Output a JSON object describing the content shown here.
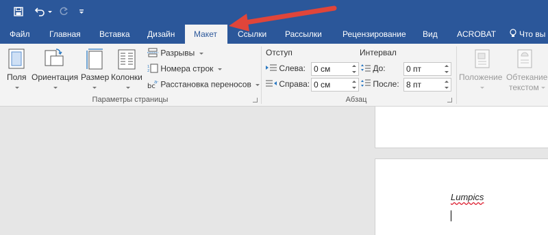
{
  "tabs": [
    {
      "label": "Файл"
    },
    {
      "label": "Главная"
    },
    {
      "label": "Вставка"
    },
    {
      "label": "Дизайн"
    },
    {
      "label": "Макет",
      "active": true
    },
    {
      "label": "Ссылки"
    },
    {
      "label": "Рассылки"
    },
    {
      "label": "Рецензирование"
    },
    {
      "label": "Вид"
    },
    {
      "label": "ACROBAT"
    },
    {
      "label": "Что вы"
    }
  ],
  "page_setup": {
    "margins": "Поля",
    "orientation": "Ориентация",
    "size": "Размер",
    "columns": "Колонки",
    "breaks": "Разрывы",
    "line_numbers": "Номера строк",
    "hyphenation": "Расстановка переносов",
    "group_label": "Параметры страницы"
  },
  "paragraph": {
    "indent_header": "Отступ",
    "spacing_header": "Интервал",
    "left_label": "Слева:",
    "left_value": "0 см",
    "right_label": "Справа:",
    "right_value": "0 см",
    "before_label": "До:",
    "before_value": "0 пт",
    "after_label": "После:",
    "after_value": "8 пт",
    "group_label": "Абзац"
  },
  "arrange": {
    "position": "Положение",
    "wrap_line1": "Обтекание",
    "wrap_line2": "текстом"
  },
  "document": {
    "text": "Lumpics"
  },
  "colors": {
    "brand": "#2b579a",
    "annotation_arrow": "#e0453a"
  },
  "icons": {
    "save": "save-icon",
    "undo": "undo-icon",
    "redo": "redo-icon",
    "customize": "customize-qat-icon",
    "search": "lightbulb-icon"
  }
}
